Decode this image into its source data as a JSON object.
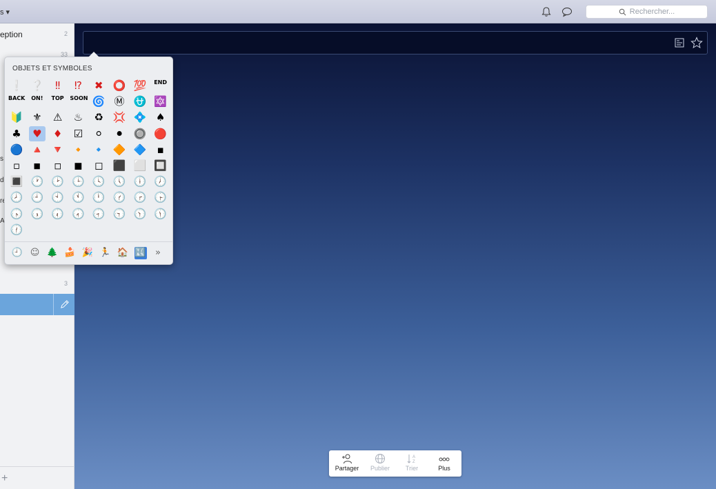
{
  "topbar": {
    "left_label": "s ▾",
    "search_placeholder": "Rechercher..."
  },
  "sidebar": {
    "rows": [
      {
        "label": "eption",
        "count": "2"
      },
      {
        "label": "",
        "count": "33"
      },
      {
        "label": "",
        "count": "3"
      }
    ],
    "fragments": [
      "s",
      "d",
      "re",
      "A"
    ]
  },
  "emoji_picker": {
    "title": "OBJETS ET SYMBOLES",
    "rows": [
      [
        "❕",
        "❔",
        "‼",
        "⁉",
        "✖",
        "⭕",
        "💯",
        "END"
      ],
      [
        "BACK",
        "ON!",
        "TOP",
        "SOON",
        "🌀",
        "Ⓜ",
        "⛎",
        "🔯"
      ],
      [
        "🔰",
        "⚜",
        "⚠",
        "♨",
        "♻",
        "💢",
        "💠",
        "♠"
      ],
      [
        "♣",
        "♥",
        "♦",
        "☑",
        "⚪",
        "⚫",
        "🔘",
        "🔴"
      ],
      [
        "🔵",
        "🔺",
        "🔻",
        "🔸",
        "🔹",
        "🔶",
        "🔷",
        "▪"
      ],
      [
        "▫",
        "◾",
        "◽",
        "◼",
        "◻",
        "⬛",
        "⬜",
        "🔲"
      ],
      [
        "🔳",
        "🕐",
        "🕑",
        "🕒",
        "🕓",
        "🕔",
        "🕕",
        "🕖"
      ],
      [
        "🕗",
        "🕘",
        "🕙",
        "🕚",
        "🕛",
        "🕜",
        "🕝",
        "🕞"
      ],
      [
        "🕟",
        "🕠",
        "🕡",
        "🕢",
        "🕣",
        "🕤",
        "🕥",
        "🕦"
      ],
      [
        "🕧"
      ]
    ],
    "selected": "♥",
    "categories": [
      "🕘",
      "☺",
      "🌲",
      "🍰",
      "🎉",
      "🏃",
      "🏠",
      "🔣",
      "»"
    ]
  },
  "toolbar": {
    "items": [
      {
        "label": "Partager",
        "icon": "share-person-icon"
      },
      {
        "label": "Publier",
        "icon": "globe-icon"
      },
      {
        "label": "Trier",
        "icon": "sort-az-icon"
      },
      {
        "label": "Plus",
        "icon": "more-icon"
      }
    ]
  },
  "colors": {
    "accent": "#6ba5dc",
    "topbar": "#c9cddf"
  }
}
